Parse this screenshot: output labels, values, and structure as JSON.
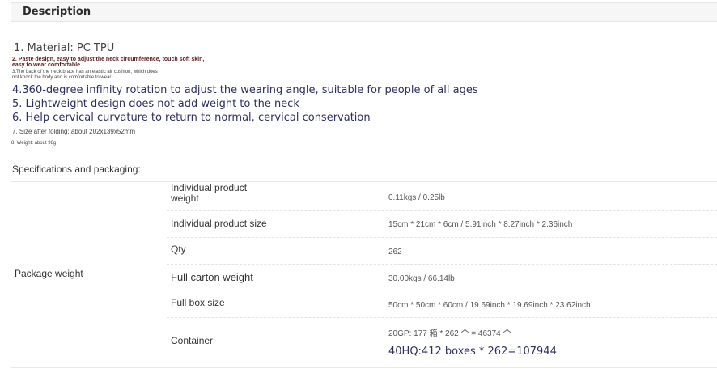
{
  "header": {
    "title": "Description"
  },
  "description": {
    "l1": "1. Material: PC TPU",
    "l2a": "2. Paste design, easy to adjust the neck circumference, touch soft skin,",
    "l2b": "easy to wear comfortable",
    "l3a": "3.The back of the neck brace has an elastic air cushion, which does",
    "l3b": "not knock the body and is comfortable to wear.",
    "l4": "4.360-degree infinity rotation to adjust the wearing angle, suitable for people of all ages",
    "l5": "5. Lightweight design does not add weight to the neck",
    "l6": "6. Help cervical curvature to return to normal, cervical conservation",
    "l7": "7. Size after folding: about 202x139x52mm",
    "l8": "8. Weight: about 98g"
  },
  "specs": {
    "title": "Specifications and packaging:",
    "group_label": "Package weight",
    "rows": [
      {
        "key_line1": "Individual product",
        "key_line2": "weight",
        "value": "0.11kgs / 0.25lb"
      },
      {
        "key": "Individual product size",
        "value": "15cm * 21cm * 6cm / 5.91inch * 8.27inch * 2.36inch"
      },
      {
        "key": "Qty",
        "value": "262"
      },
      {
        "key": "Full carton weight",
        "value": "30.00kgs / 66.14lb"
      },
      {
        "key": "Full box size",
        "value": "50cm * 50cm * 60cm / 19.69inch * 19.69inch * 23.62inch"
      },
      {
        "key": "Container",
        "value_line1": "20GP: 177 箱 * 262 个 = 46374 个",
        "value_line2": "40HQ:412 boxes * 262=107944"
      }
    ]
  }
}
